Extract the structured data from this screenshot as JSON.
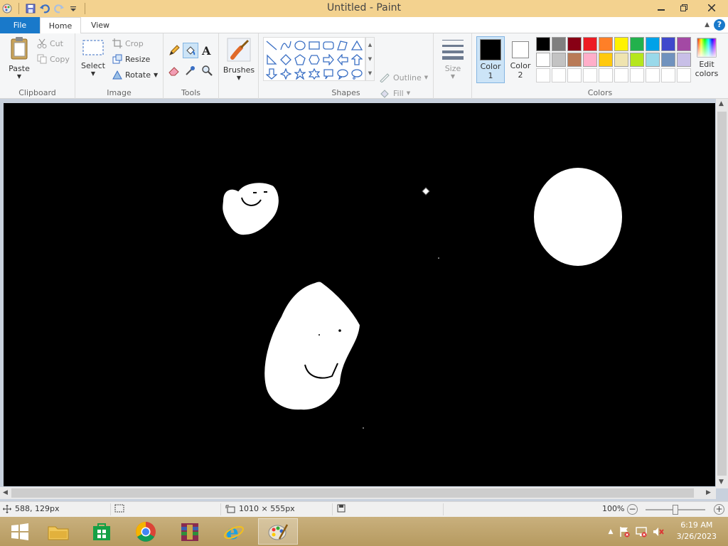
{
  "window": {
    "title": "Untitled - Paint"
  },
  "tabs": {
    "file": "File",
    "home": "Home",
    "view": "View"
  },
  "clipboard": {
    "paste": "Paste",
    "cut": "Cut",
    "copy": "Copy",
    "label": "Clipboard"
  },
  "image": {
    "select": "Select",
    "crop": "Crop",
    "resize": "Resize",
    "rotate": "Rotate",
    "label": "Image"
  },
  "tools": {
    "label": "Tools"
  },
  "brushes": {
    "label": "Brushes"
  },
  "shapes": {
    "outline": "Outline",
    "fill": "Fill",
    "label": "Shapes"
  },
  "size": {
    "label": "Size"
  },
  "colors": {
    "color1_label": "Color",
    "color1_num": "1",
    "color2_label": "Color",
    "color2_num": "2",
    "edit_label": "Edit",
    "edit_label2": "colors",
    "label": "Colors",
    "color1_value": "#000000",
    "color2_value": "#ffffff",
    "palette_row1": [
      "#000000",
      "#7f7f7f",
      "#880015",
      "#ed1c24",
      "#ff7f27",
      "#fff200",
      "#22b14c",
      "#00a2e8",
      "#3f48cc",
      "#a349a4"
    ],
    "palette_row2": [
      "#ffffff",
      "#c3c3c3",
      "#b97a57",
      "#ffaec9",
      "#ffc90e",
      "#efe4b0",
      "#b5e61d",
      "#99d9ea",
      "#7092be",
      "#c8bfe7"
    ],
    "palette_row3": [
      "#ffffff",
      "#ffffff",
      "#ffffff",
      "#ffffff",
      "#ffffff",
      "#ffffff",
      "#ffffff",
      "#ffffff",
      "#ffffff",
      "#ffffff"
    ]
  },
  "status": {
    "cursor_pos": "588, 129px",
    "canvas_size": "1010 × 555px",
    "zoom": "100%"
  },
  "clock": {
    "time": "6:19 AM",
    "date": "3/26/2023"
  }
}
